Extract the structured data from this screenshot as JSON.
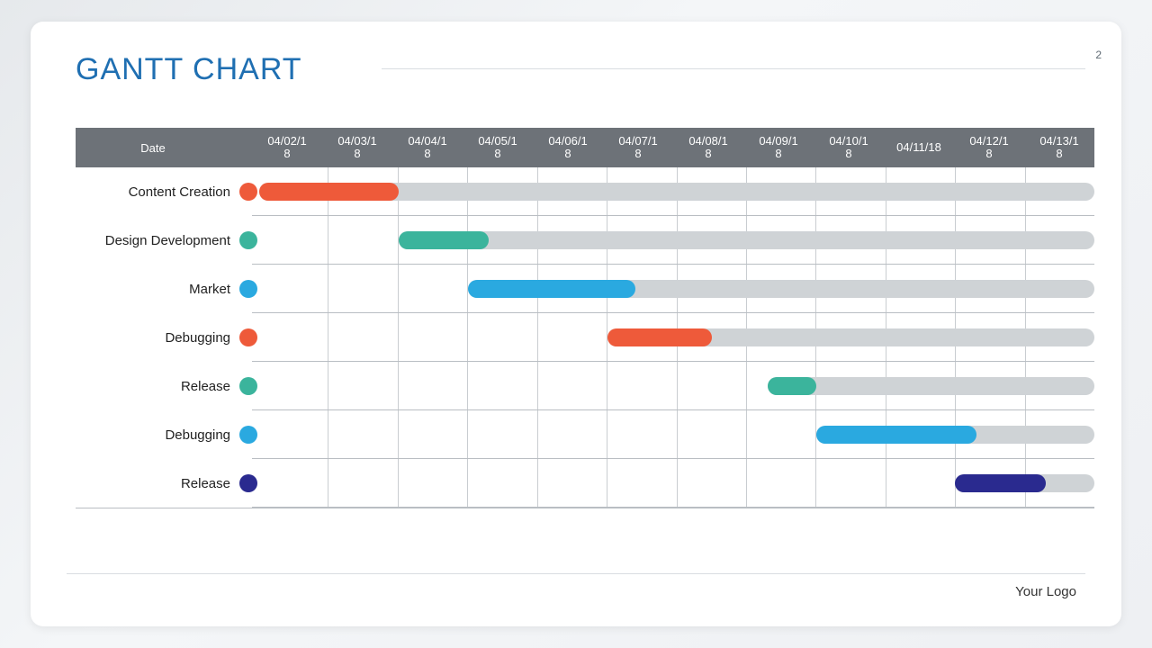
{
  "page": {
    "title": "GANTT CHART",
    "number": "2",
    "logo": "Your Logo"
  },
  "header_label": "Date",
  "dates": [
    "04/02/1\n8",
    "04/03/1\n8",
    "04/04/1\n8",
    "04/05/1\n8",
    "04/06/1\n8",
    "04/07/1\n8",
    "04/08/1\n8",
    "04/09/1\n8",
    "04/10/1\n8",
    "04/11/18",
    "04/12/1\n8",
    "04/13/1\n8"
  ],
  "chart_data": {
    "type": "bar",
    "title": "GANTT CHART",
    "xlabel": "Date",
    "x_categories": [
      "04/02/18",
      "04/03/18",
      "04/04/18",
      "04/05/18",
      "04/06/18",
      "04/07/18",
      "04/08/18",
      "04/09/18",
      "04/10/18",
      "04/11/18",
      "04/12/18",
      "04/13/18"
    ],
    "series": [
      {
        "name": "Content Creation",
        "start": "04/02/18",
        "end": "04/04/18",
        "start_idx": 0,
        "end_idx": 2,
        "bg_start_idx": 0,
        "bg_end_idx": 12,
        "color": "#ee5a3a"
      },
      {
        "name": "Design Development",
        "start": "04/04/18",
        "end": "04/05/18",
        "start_idx": 2,
        "end_idx": 3.3,
        "bg_start_idx": 2,
        "bg_end_idx": 12,
        "color": "#3bb49c"
      },
      {
        "name": "Market",
        "start": "04/05/18",
        "end": "04/07/18",
        "start_idx": 3,
        "end_idx": 5.4,
        "bg_start_idx": 3,
        "bg_end_idx": 12,
        "color": "#2aa9e0"
      },
      {
        "name": "Debugging",
        "start": "04/07/18",
        "end": "04/08/18",
        "start_idx": 5,
        "end_idx": 6.5,
        "bg_start_idx": 5,
        "bg_end_idx": 12,
        "color": "#ee5a3a"
      },
      {
        "name": "Release",
        "start": "04/09/18",
        "end": "04/10/18",
        "start_idx": 7.3,
        "end_idx": 8,
        "bg_start_idx": 7.3,
        "bg_end_idx": 12,
        "color": "#3bb49c"
      },
      {
        "name": "Debugging",
        "start": "04/10/18",
        "end": "04/12/18",
        "start_idx": 8,
        "end_idx": 10.3,
        "bg_start_idx": 8,
        "bg_end_idx": 12,
        "color": "#2aa9e0"
      },
      {
        "name": "Release",
        "start": "04/12/18",
        "end": "04/13/18",
        "start_idx": 10,
        "end_idx": 11.3,
        "bg_start_idx": 10,
        "bg_end_idx": 12,
        "color": "#2a2a8f"
      }
    ],
    "xlim": [
      0,
      12
    ]
  }
}
